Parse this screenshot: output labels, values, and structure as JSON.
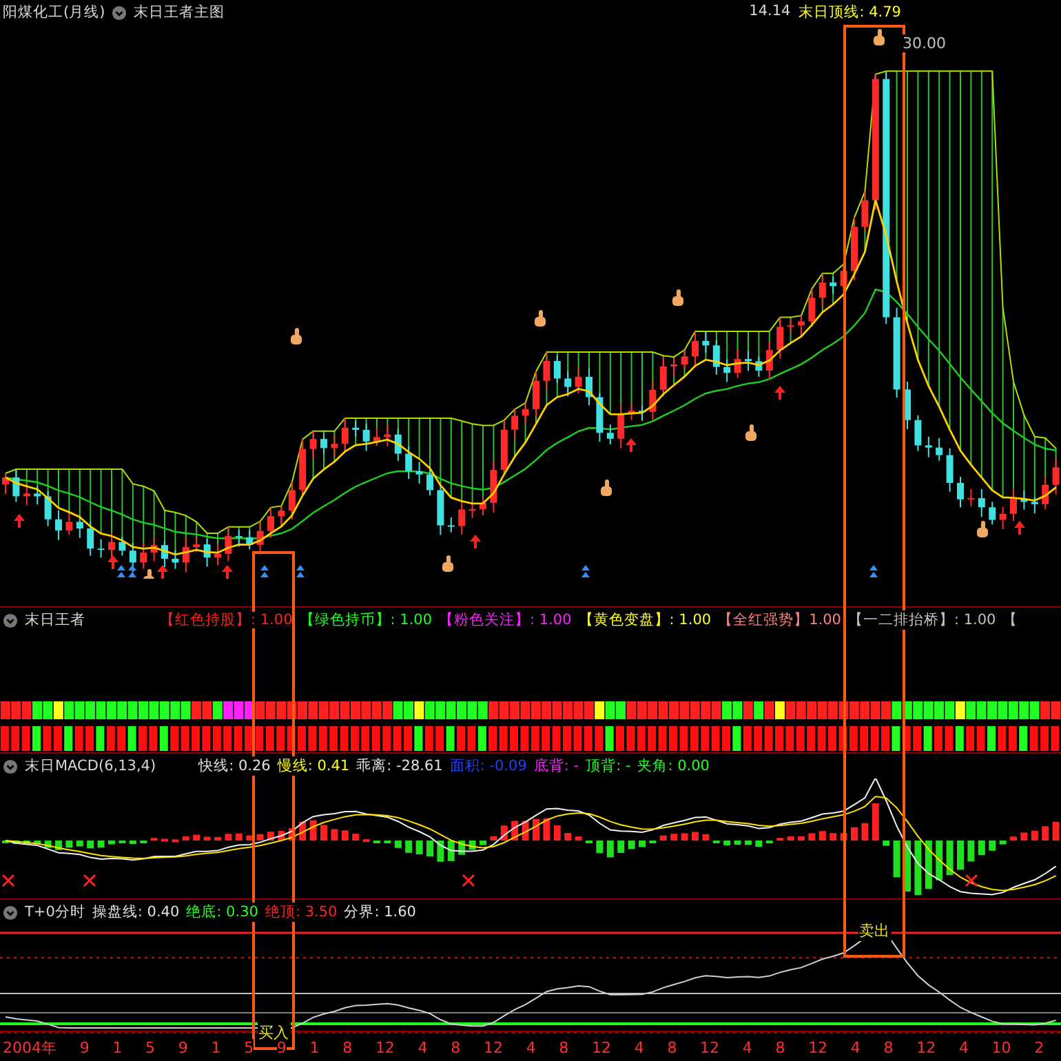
{
  "main_chart": {
    "stock_title": "阳煤化工(月线)",
    "indicator_title": "末日王者主图",
    "price": "14.14",
    "top_line_label": "末日顶线: 4.79",
    "max_price_label": "30.00"
  },
  "indicator": {
    "title": "末日王者",
    "legends": [
      {
        "label": "【红色持股】",
        "value": ": 1.00",
        "color": "#ff2020"
      },
      {
        "label": "【绿色持币】",
        "value": ": 1.00",
        "color": "#20ff20"
      },
      {
        "label": "【粉色关注】",
        "value": ": 1.00",
        "color": "#ff20ff"
      },
      {
        "label": "【黄色变盘】",
        "value": ": 1.00",
        "color": "#ffff20"
      },
      {
        "label": "【全红强势】",
        "value": "1.00",
        "color": "#ff8080"
      },
      {
        "label": "【一二排抬桥】",
        "value": ": 1.00",
        "color": "#c0c0c0"
      },
      {
        "label": "【",
        "color": "#c0c0c0"
      }
    ]
  },
  "macd": {
    "title": "末日MACD(6,13,4)",
    "fields": [
      {
        "label": "快线: 0.26",
        "color": "#e0e0e0"
      },
      {
        "label": "慢线: 0.41",
        "color": "#ffff20"
      },
      {
        "label": "乖离: -28.61",
        "color": "#e0e0e0"
      },
      {
        "label": "面积: -0.09",
        "color": "#2040ff"
      },
      {
        "label": "底背: -",
        "color": "#ff20ff"
      },
      {
        "label": "顶背: -",
        "color": "#20ff20"
      },
      {
        "label": "夹角: 0.00",
        "color": "#20ff20"
      }
    ]
  },
  "t0": {
    "title": "T+0分时",
    "fields": [
      {
        "label": "操盘线: 0.40",
        "color": "#e0e0e0"
      },
      {
        "label": "绝底: 0.30",
        "color": "#20ff20"
      },
      {
        "label": "绝顶: 3.50",
        "color": "#ff2020"
      },
      {
        "label": "分界: 1.60",
        "color": "#e0e0e0"
      }
    ]
  },
  "signals": [
    {
      "kind": "buy",
      "label": "买入"
    },
    {
      "kind": "sell",
      "label": "卖出"
    }
  ],
  "time_axis": [
    "2004年",
    "9",
    "1",
    "5",
    "9",
    "1",
    "5",
    "9",
    "1",
    "8",
    "12",
    "4",
    "8",
    "12",
    "4",
    "8",
    "12",
    "4",
    "8",
    "12",
    "4",
    "8",
    "12",
    "4",
    "8",
    "12",
    "4",
    "10",
    "2"
  ]
}
